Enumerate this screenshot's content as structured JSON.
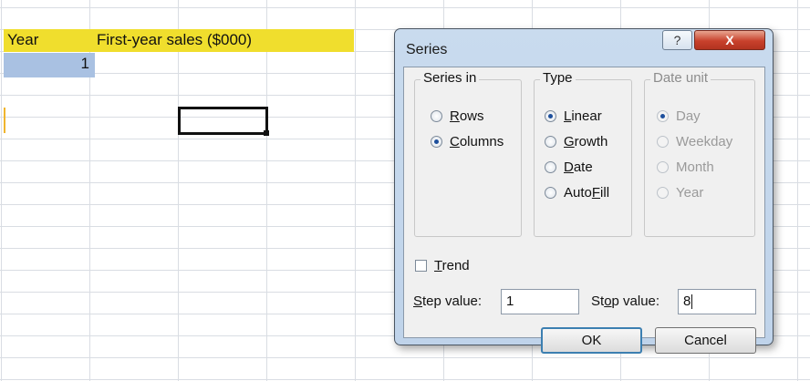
{
  "sheet": {
    "a1": "Year",
    "b1": "First-year sales ($000)",
    "a2": "1"
  },
  "dialog": {
    "title": "Series",
    "help_glyph": "?",
    "close_glyph": "X",
    "series_in": {
      "label": "Series in",
      "options": [
        {
          "pre": "",
          "acc": "R",
          "post": "ows",
          "checked": false
        },
        {
          "pre": "",
          "acc": "C",
          "post": "olumns",
          "checked": true
        }
      ]
    },
    "type": {
      "label": "Type",
      "options": [
        {
          "pre": "",
          "acc": "L",
          "post": "inear",
          "checked": true
        },
        {
          "pre": "",
          "acc": "G",
          "post": "rowth",
          "checked": false
        },
        {
          "pre": "",
          "acc": "D",
          "post": "ate",
          "checked": false
        },
        {
          "pre": "Auto",
          "acc": "F",
          "post": "ill",
          "checked": false
        }
      ]
    },
    "date_unit": {
      "label": "Date unit",
      "options": [
        {
          "text": "Day",
          "checked": true
        },
        {
          "text": "Weekday",
          "checked": false
        },
        {
          "text": "Month",
          "checked": false
        },
        {
          "text": "Year",
          "checked": false
        }
      ]
    },
    "trend": {
      "pre": "",
      "acc": "T",
      "post": "rend",
      "checked": false
    },
    "step": {
      "pre": "",
      "acc": "S",
      "post": "tep value:",
      "value": "1"
    },
    "stop": {
      "pre": "St",
      "acc": "o",
      "post": "p value:",
      "value": "8"
    },
    "ok_label": "OK",
    "cancel_label": "Cancel"
  }
}
